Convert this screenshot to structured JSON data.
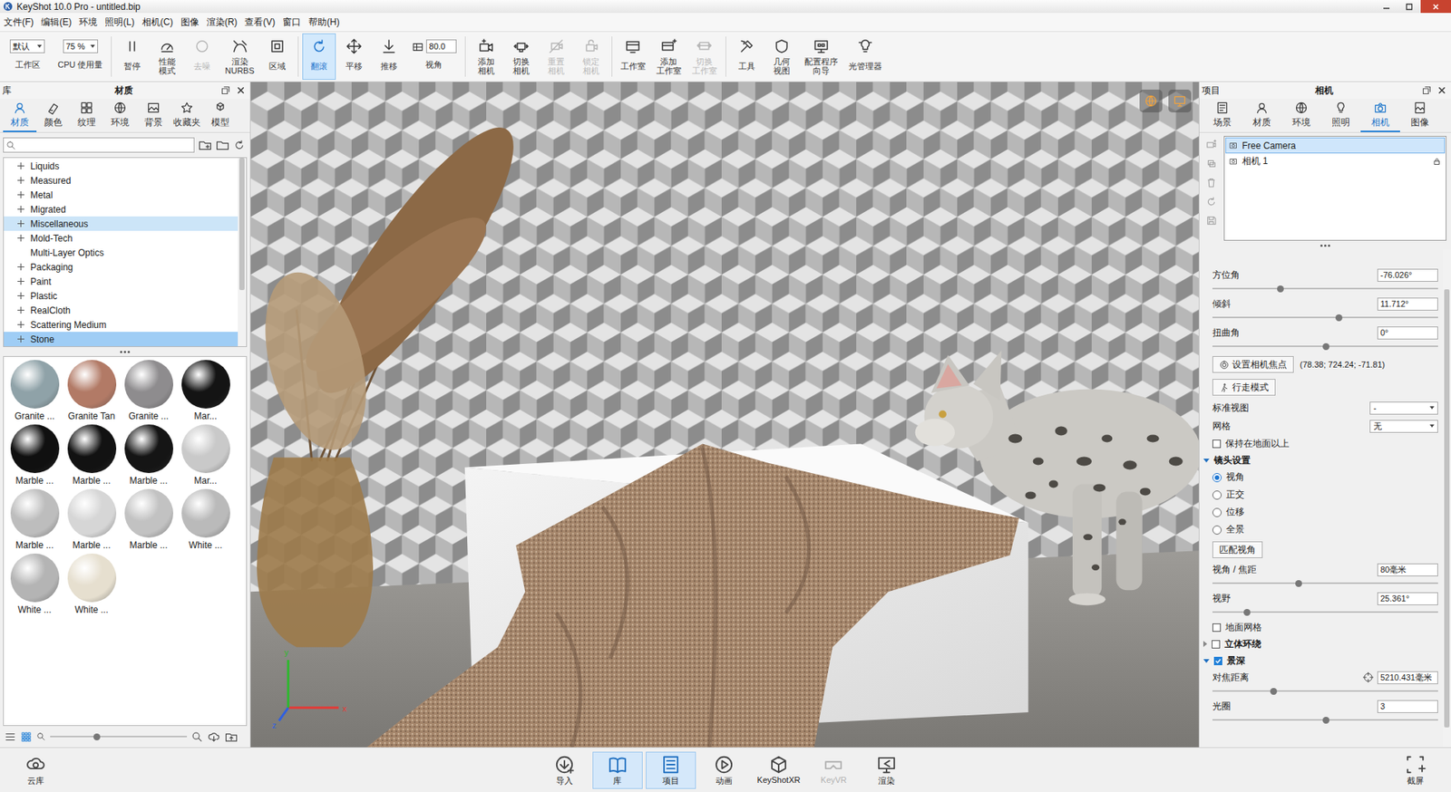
{
  "window": {
    "title": "KeyShot 10.0 Pro - untitled.bip"
  },
  "menu": [
    "文件(F)",
    "编辑(E)",
    "环境",
    "照明(L)",
    "相机(C)",
    "图像",
    "渲染(R)",
    "查看(V)",
    "窗口",
    "帮助(H)"
  ],
  "toolbar": [
    [
      {
        "kind": "select",
        "value": "默认",
        "label": "工作区"
      },
      {
        "kind": "select",
        "value": "75 %",
        "label": "CPU 使用量"
      }
    ],
    [
      {
        "kind": "button",
        "label": "暂停",
        "selected": false,
        "disabled": false
      },
      {
        "kind": "button",
        "label": "性能\n模式",
        "selected": false,
        "disabled": false
      },
      {
        "kind": "button",
        "label": "去噪",
        "selected": false,
        "disabled": true
      },
      {
        "kind": "button",
        "label": "渲染\nNURBS",
        "selected": false,
        "disabled": false
      },
      {
        "kind": "button",
        "label": "区域",
        "selected": false,
        "disabled": false
      }
    ],
    [
      {
        "kind": "button",
        "label": "翻滚",
        "selected": true,
        "disabled": false
      },
      {
        "kind": "button",
        "label": "平移",
        "selected": false,
        "disabled": false
      },
      {
        "kind": "button",
        "label": "推移",
        "selected": false,
        "disabled": false
      },
      {
        "kind": "field",
        "value": "80.0",
        "label": "视角"
      }
    ],
    [
      {
        "kind": "button",
        "label": "添加\n相机",
        "selected": false,
        "disabled": false
      },
      {
        "kind": "button",
        "label": "切换\n相机",
        "selected": false,
        "disabled": false
      },
      {
        "kind": "button",
        "label": "重置\n相机",
        "selected": false,
        "disabled": true
      },
      {
        "kind": "button",
        "label": "锁定\n相机",
        "selected": false,
        "disabled": true
      }
    ],
    [
      {
        "kind": "button",
        "label": "工作室",
        "selected": false,
        "disabled": false
      },
      {
        "kind": "button",
        "label": "添加\n工作室",
        "selected": false,
        "disabled": false
      },
      {
        "kind": "button",
        "label": "切换\n工作室",
        "selected": false,
        "disabled": true
      }
    ],
    [
      {
        "kind": "button",
        "label": "工具",
        "selected": false,
        "disabled": false
      },
      {
        "kind": "button",
        "label": "几何\n视图",
        "selected": false,
        "disabled": false
      },
      {
        "kind": "button",
        "label": "配置程序\n向导",
        "selected": false,
        "disabled": false
      },
      {
        "kind": "button",
        "label": "光管理器",
        "selected": false,
        "disabled": false
      }
    ]
  ],
  "viewport": {
    "axes": [
      {
        "label": "x",
        "color": "#e53935"
      },
      {
        "label": "y",
        "color": "#2eb82e"
      },
      {
        "label": "z",
        "color": "#2f5fe0"
      }
    ]
  },
  "library": {
    "dock_label": "库",
    "title": "材质",
    "tabs": [
      {
        "label": "材质",
        "selected": true
      },
      {
        "label": "颜色",
        "selected": false
      },
      {
        "label": "纹理",
        "selected": false
      },
      {
        "label": "环境",
        "selected": false
      },
      {
        "label": "背景",
        "selected": false
      },
      {
        "label": "收藏夹",
        "selected": false
      },
      {
        "label": "模型",
        "selected": false
      }
    ],
    "categories": [
      {
        "label": "Liquids",
        "expandable": true,
        "selected": false,
        "hovered": false
      },
      {
        "label": "Measured",
        "expandable": true,
        "selected": false,
        "hovered": false
      },
      {
        "label": "Metal",
        "expandable": true,
        "selected": false,
        "hovered": false
      },
      {
        "label": "Migrated",
        "expandable": true,
        "selected": false,
        "hovered": false
      },
      {
        "label": "Miscellaneous",
        "expandable": true,
        "selected": false,
        "hovered": true
      },
      {
        "label": "Mold-Tech",
        "expandable": true,
        "selected": false,
        "hovered": false
      },
      {
        "label": "Multi-Layer Optics",
        "expandable": false,
        "selected": false,
        "hovered": false
      },
      {
        "label": "Packaging",
        "expandable": true,
        "selected": false,
        "hovered": false
      },
      {
        "label": "Paint",
        "expandable": true,
        "selected": false,
        "hovered": false
      },
      {
        "label": "Plastic",
        "expandable": true,
        "selected": false,
        "hovered": false
      },
      {
        "label": "RealCloth",
        "expandable": true,
        "selected": false,
        "hovered": false
      },
      {
        "label": "Scattering Medium",
        "expandable": true,
        "selected": false,
        "hovered": false
      },
      {
        "label": "Stone",
        "expandable": true,
        "selected": true,
        "hovered": false
      }
    ],
    "materials": [
      {
        "label": "Granite ...",
        "color": "#8fa2a8"
      },
      {
        "label": "Granite Tan",
        "color": "#b27a66"
      },
      {
        "label": "Granite ...",
        "color": "#8e8c8e"
      },
      {
        "label": "Mar...",
        "color": "#141414"
      },
      {
        "label": "Marble ...",
        "color": "#101010"
      },
      {
        "label": "Marble ...",
        "color": "#121212"
      },
      {
        "label": "Marble ...",
        "color": "#151515"
      },
      {
        "label": "Mar...",
        "color": "#c9c9c9"
      },
      {
        "label": "Marble ...",
        "color": "#bdbdbd"
      },
      {
        "label": "Marble ...",
        "color": "#d6d6d6"
      },
      {
        "label": "Marble ...",
        "color": "#c2c2c2"
      },
      {
        "label": "White ...",
        "color": "#bababa"
      },
      {
        "label": "White ...",
        "color": "#b4b4b4"
      },
      {
        "label": "White ...",
        "color": "#e6dfcf"
      }
    ],
    "zoom_level": 0.34
  },
  "project": {
    "dock_label": "项目",
    "title": "相机",
    "tabs": [
      {
        "label": "场景",
        "selected": false
      },
      {
        "label": "材质",
        "selected": false
      },
      {
        "label": "环境",
        "selected": false
      },
      {
        "label": "照明",
        "selected": false
      },
      {
        "label": "相机",
        "selected": true
      },
      {
        "label": "图像",
        "selected": false
      }
    ],
    "cameras": [
      {
        "name": "Free Camera",
        "selected": true,
        "locked": false
      },
      {
        "name": "相机 1",
        "selected": false,
        "locked": true
      }
    ],
    "properties": [
      {
        "kind": "slider",
        "label": "方位角",
        "value": "-76.026°",
        "level": 0.3
      },
      {
        "kind": "slider",
        "label": "倾斜",
        "value": "11.712°",
        "level": 0.56
      },
      {
        "kind": "slider",
        "label": "扭曲角",
        "value": "0°",
        "level": 0.5
      },
      {
        "kind": "focus-button",
        "label": "设置相机焦点",
        "note": "(78.38; 724.24; -71.81)"
      },
      {
        "kind": "walk-button",
        "label": "行走模式"
      },
      {
        "kind": "dropdown",
        "label": "标准视图",
        "value": "-"
      },
      {
        "kind": "dropdown",
        "label": "网格",
        "value": "无"
      },
      {
        "kind": "checkbox",
        "label": "保持在地面以上",
        "checked": false
      },
      {
        "kind": "section",
        "label": "镜头设置",
        "expanded": true
      },
      {
        "kind": "radio",
        "label": "视角",
        "selected": true
      },
      {
        "kind": "radio",
        "label": "正交",
        "selected": false
      },
      {
        "kind": "radio",
        "label": "位移",
        "selected": false
      },
      {
        "kind": "radio",
        "label": "全景",
        "selected": false
      },
      {
        "kind": "button",
        "label": "匹配视角"
      },
      {
        "kind": "slider",
        "label": "视角 / 焦距",
        "value": "80毫米",
        "level": 0.38
      },
      {
        "kind": "slider",
        "label": "视野",
        "value": "25.361°",
        "level": 0.15
      },
      {
        "kind": "checkbox",
        "label": "地面网格",
        "checked": false
      },
      {
        "kind": "check-section",
        "label": "立体环绕",
        "expanded": false,
        "checked": false
      },
      {
        "kind": "check-section",
        "label": "景深",
        "expanded": true,
        "checked": true
      },
      {
        "kind": "target-slider",
        "label": "对焦距离",
        "value": "5210.431毫米",
        "level": 0.27
      },
      {
        "kind": "slider",
        "label": "光圈",
        "value": "3",
        "level": 0.5
      }
    ]
  },
  "dock": {
    "left": {
      "label": "云库",
      "selected": false,
      "disabled": false
    },
    "center": [
      {
        "label": "导入",
        "selected": false,
        "disabled": false
      },
      {
        "label": "库",
        "selected": true,
        "disabled": false
      },
      {
        "label": "项目",
        "selected": true,
        "disabled": false
      },
      {
        "label": "动画",
        "selected": false,
        "disabled": false
      },
      {
        "label": "KeyShotXR",
        "selected": false,
        "disabled": false
      },
      {
        "label": "KeyVR",
        "selected": false,
        "disabled": true
      },
      {
        "label": "渲染",
        "selected": false,
        "disabled": false
      }
    ],
    "right": {
      "label": "截屏",
      "selected": false,
      "disabled": false
    }
  }
}
